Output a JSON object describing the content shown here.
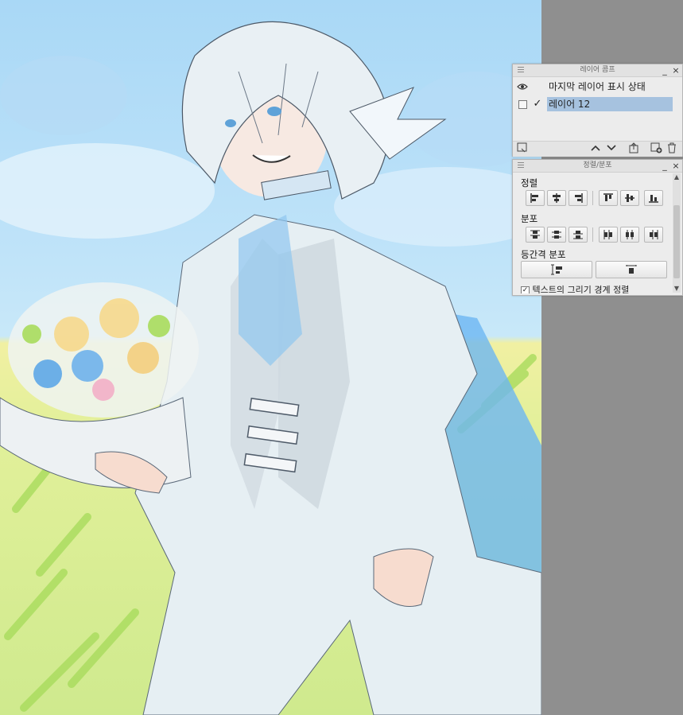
{
  "layer_comp_panel": {
    "title": "레이어 콤프",
    "rows": [
      {
        "label": "마지막 레이어 표시 상태",
        "visibility_icon": "eye-icon"
      },
      {
        "label": "레이어 12",
        "applied_mark": "✓"
      }
    ],
    "footer_icons": [
      "comp-settings-icon",
      "arrow-up-icon",
      "arrow-down-icon",
      "update-comp-icon",
      "new-comp-icon",
      "trash-icon"
    ]
  },
  "align_panel": {
    "title": "정렬/분포",
    "sections": {
      "align": "정렬",
      "distribute": "분포",
      "even_spacing": "등간격 분포"
    },
    "text_option": "텍스트의 그리기 경계 정렬",
    "text_option_checked": true
  },
  "colors": {
    "panel_bg": "#ececec",
    "selection": "#a6c2df",
    "workspace": "#8f8f8f"
  }
}
